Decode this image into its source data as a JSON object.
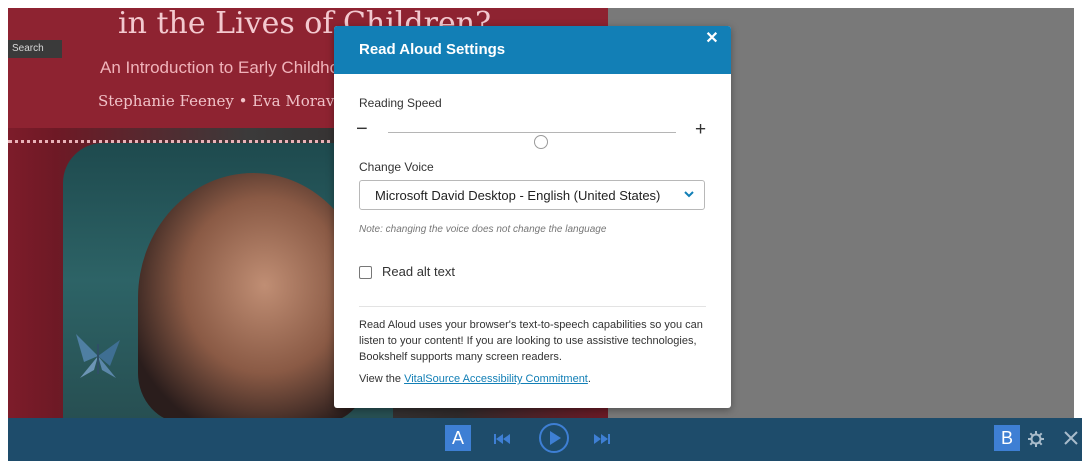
{
  "colors": {
    "accent": "#127fb6",
    "bottom_bar": "#1e4c6b",
    "badge": "#3e7fd4",
    "cover": "#8e2331",
    "backdrop": "#797979"
  },
  "book_cover": {
    "title": "in the Lives of Children?",
    "subtitle": "An Introduction to Early Childhood Education",
    "authors": "Stephanie Feeney • Eva Moravcik"
  },
  "search_tab": {
    "label": "Search",
    "icon": "search-tab"
  },
  "dialog": {
    "title": "Read Aloud Settings",
    "close_icon": "close-icon",
    "reading_speed_label": "Reading Speed",
    "speed_decrease": "−",
    "speed_increase": "+",
    "speed_level": 0.53,
    "change_voice_label": "Change Voice",
    "voice_value": "Microsoft David Desktop - English (United States)",
    "note": "Note: changing the voice does not change the language",
    "read_alt_text_label": "Read alt text",
    "read_alt_text_checked": false,
    "info_text": "Read Aloud uses your browser's text-to-speech capabilities so you can listen to your content! If you are looking to use assistive technologies, Bookshelf supports many screen readers.",
    "view_prefix": "View the ",
    "accessibility_link": "VitalSource Accessibility Commitment",
    "view_suffix": "."
  },
  "bottom_bar": {
    "badge_a": "A",
    "badge_b": "B",
    "controls": [
      "skip-back-icon",
      "play-icon",
      "skip-forward-icon",
      "gear-icon",
      "close-icon"
    ]
  }
}
